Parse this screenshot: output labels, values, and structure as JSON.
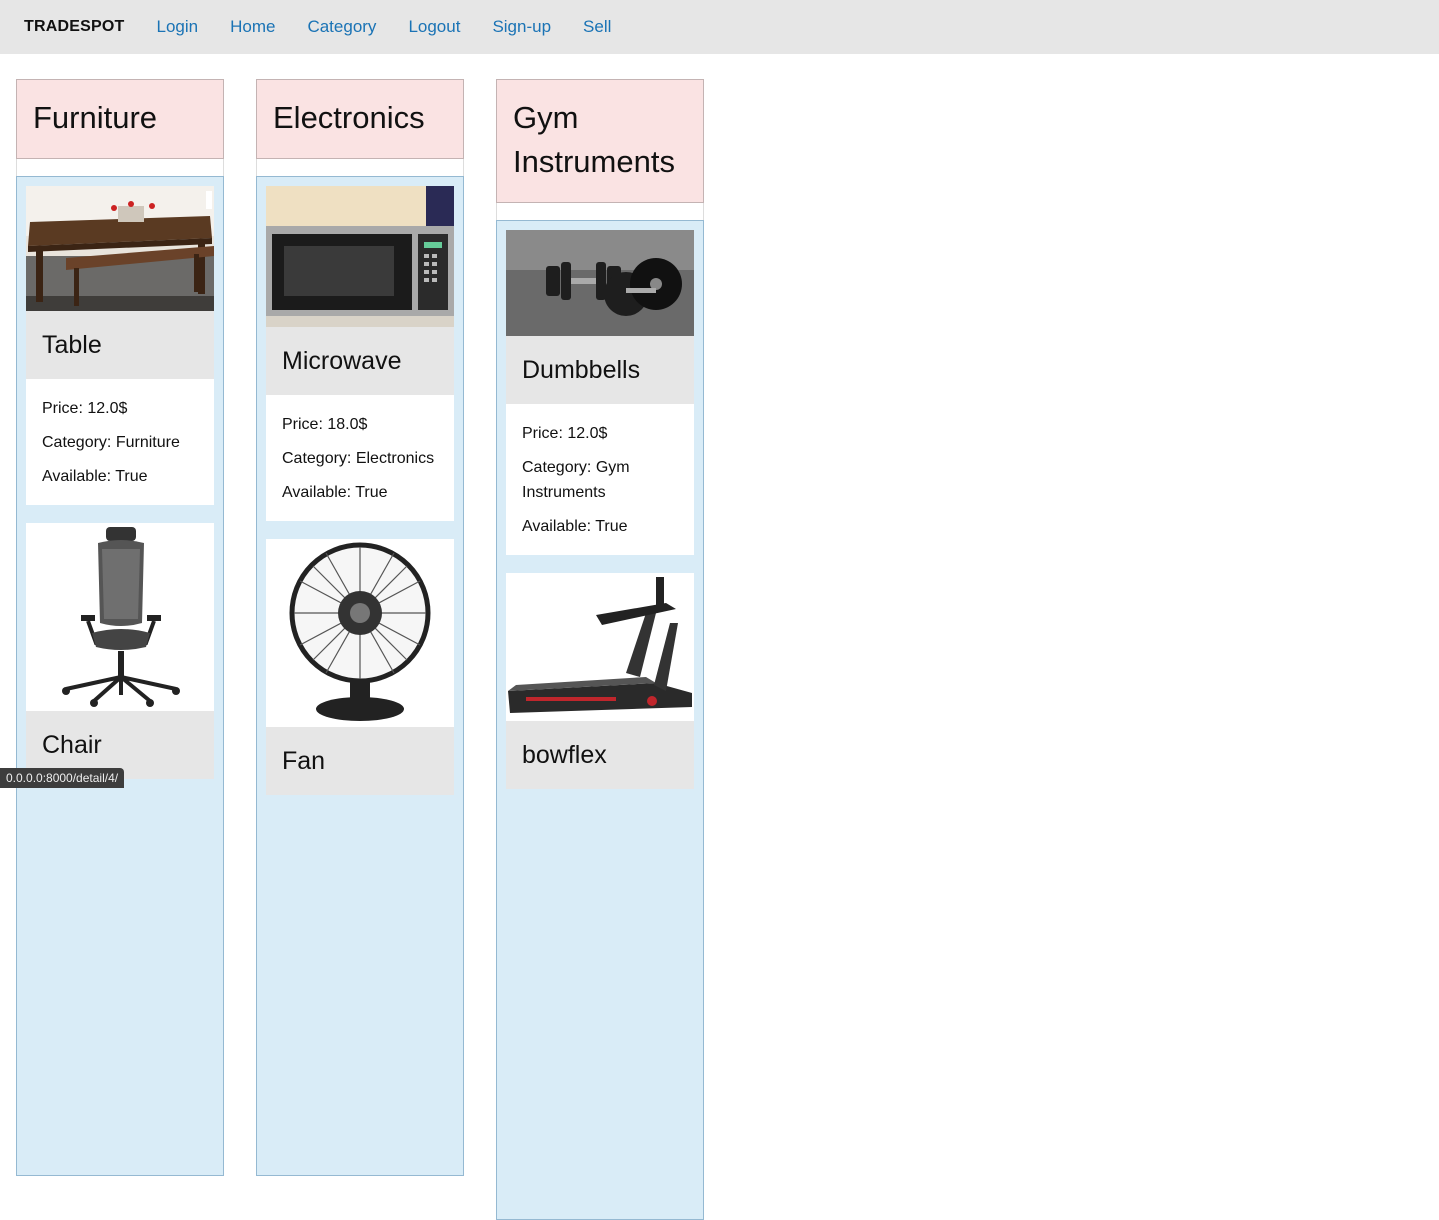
{
  "nav": {
    "brand": "TRADESPOT",
    "links": [
      "Login",
      "Home",
      "Category",
      "Logout",
      "Sign-up",
      "Sell"
    ]
  },
  "categories": [
    {
      "title": "Furniture",
      "products": [
        {
          "name": "Table",
          "price": "Price: 12.0$",
          "category": "Category: Furniture",
          "available": "Available: True",
          "image": "dining-table-photo"
        },
        {
          "name": "Chair",
          "image": "office-chair-photo"
        }
      ]
    },
    {
      "title": "Electronics",
      "products": [
        {
          "name": "Microwave",
          "price": "Price: 18.0$",
          "category": "Category: Electronics",
          "available": "Available: True",
          "image": "microwave-photo"
        },
        {
          "name": "Fan",
          "image": "desk-fan-photo"
        }
      ]
    },
    {
      "title": "Gym Instruments",
      "products": [
        {
          "name": "Dumbbells",
          "price": "Price: 12.0$",
          "category": "Category: Gym Instruments",
          "available": "Available: True",
          "image": "dumbbells-photo"
        },
        {
          "name": "bowflex",
          "image": "treadmill-photo"
        }
      ]
    }
  ],
  "status_url": "0.0.0.0:8000/detail/4/"
}
